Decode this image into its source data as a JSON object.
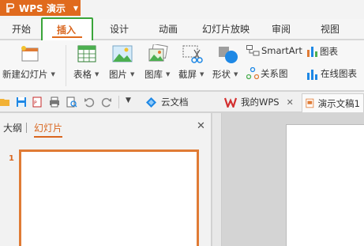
{
  "app": {
    "title": "WPS 演示"
  },
  "tabs": [
    "开始",
    "插入",
    "设计",
    "动画",
    "幻灯片放映",
    "审阅",
    "视图"
  ],
  "active_tab": "插入",
  "ribbon": {
    "new_slide": "新建幻灯片",
    "table": "表格",
    "picture": "图片",
    "gallery": "图库",
    "screenshot": "截屏",
    "shape": "形状",
    "smartart": "SmartArt",
    "relation": "关系图",
    "chart": "图表",
    "online_chart": "在线图表"
  },
  "doc_tabs": {
    "cloud": "云文档",
    "my_wps": "我的WPS",
    "current": "演示文稿1"
  },
  "pane": {
    "outline": "大纲",
    "slides": "幻灯片",
    "slide_number": "1"
  },
  "colors": {
    "accent": "#e06a1d",
    "highlight": "#3aa53a"
  }
}
